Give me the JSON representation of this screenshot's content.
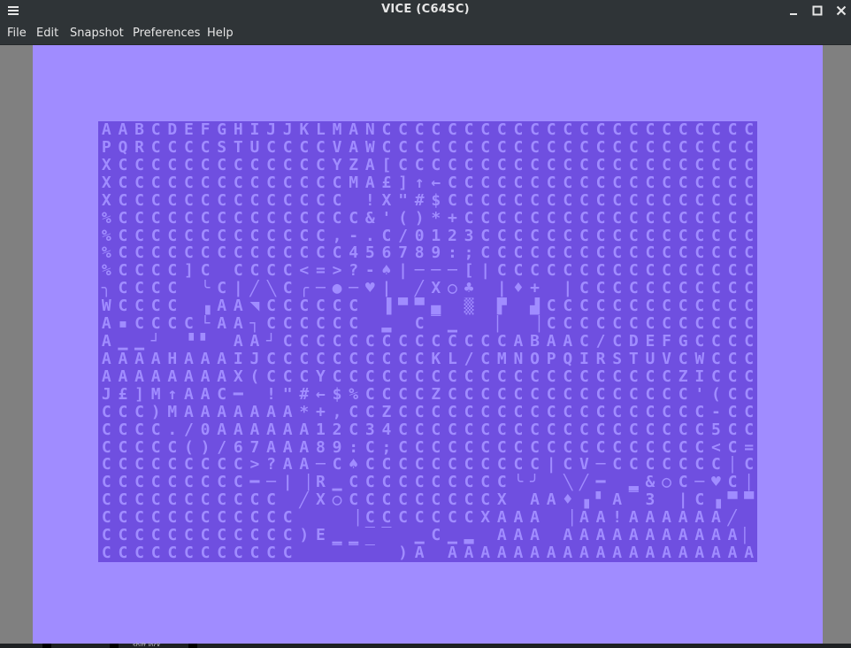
{
  "window": {
    "title": "VICE (C64SC)",
    "menu_icon": "hamburger-icon",
    "minimize_glyph": "_",
    "maximize_glyph": "□",
    "close_glyph": "✕"
  },
  "menubar": {
    "items": [
      "File",
      "Edit",
      "Snapshot",
      "Preferences",
      "Help"
    ]
  },
  "colors": {
    "window_chrome": "#2f3437",
    "c64_border": "#a08cff",
    "c64_background": "#6f4fe0",
    "viewport_gray": "#808080"
  },
  "c64_screen": {
    "columns": 40,
    "rows": [
      "AABCDEFGHIJJKLMANCCCCCCCCCCCCCCCCCCCCCCC",
      "PQRCCCCSTUCCCCVAWCCCCCCCCCCCCCCCCCCCCCCC",
      "XCCCCCCCCCCCCCYZA[CCCCCCCCCCCCCCCCCCCCCC",
      "XCCCCCCCCCCCCCCMA£]↑←CCCCCCCCCCCCCCCCCCC",
      "XCCCCCCCCCCCCCC !X\"#$CCCCCCCCCCCCCCCCCCC",
      "%CCCCCCCCCCCCCCC&'()*+CCCCCCCCCCCCCCCCCC",
      "%CCCCCCCCCCCCC,-.C/0123CCCCCCCCCCCCCCCCC",
      "%CCCCCCCCCCCCCC456789:;CCCCCCCCCCCCCCCCC",
      "%CCCC]C CCCC<=>?-♠|───[|CCCCCCCCCCCCCCCC",
      "╮CCCC ╰C|╱╲C╭─●─♥| ╱X○♣ |♦+ |CCCCCCCCCCC",
      "WCCCC ▗AA◥CCCCCC ▐▀▀▄ ▒ ▛ ▟CCCCCCCCCCCCC",
      "A▪CCCC└AA┐CCCCCC ▂ C▔▁  ▏ ▕CCCCCCCCCCCCC",
      "A▁▁┘ ▝▘ AA┘CCCCCCCCCCCCCCABAAC/CDEFGCCCCC",
      "AAAAHAAAIJCCCCCCCCCCKL/CMNOPQIRSTUVCWCCCC",
      "AAAAAAAAX(CCCYCCCCCCCCCCCCCCCCCCCCCZICCC",
      "J£]M↑AAC━ !\"#←$%CCCCZCCCCCCCCCCCCCCC'(CC",
      "CCC)MAAAAAAA*+,CCZCCCCCCCCCCCCCCCCCCC-CC",
      "CCCC./0AAAAAA12C34CCCCCCCCCCCCCCCCCCC5CC",
      "CCCCC()/67AAA89:C;CCCCCCCCCCCCCCCCCCC<C=",
      "CCCCCCCCC>?AA─C♠CCCCCCCCCCC|CV─CCCCCCC│C",
      "CCCCCCCCC━─|▕R▁CCCCCCCCCC╰╯ ╲╱━ ▂&○C─♥C│V",
      "CCCCCCCCCCC ╱X○CCCCCCCCCX AA♦▗▘A▔3 |C▗▀▀C",
      "CCCCCCCCCCCC   ▕CCCCCCCXAAA ▕AA!AAAAAA╱ C",
      "CCCCCCCCCCCC)E▁▁▔▔ ▁C▁▂ AAA AAAAAAAAAAA▏ ",
      "CCCCCCCCCCCC  ▔▔▔ )A AAAAAAAAAAAAAAAAAAA"
    ]
  },
  "statusbar": {
    "label": "shift lock"
  }
}
